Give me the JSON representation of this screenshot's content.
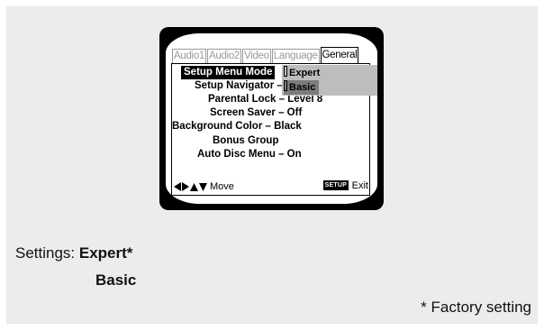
{
  "tabs": [
    {
      "label": "Audio1",
      "active": false
    },
    {
      "label": "Audio2",
      "active": false
    },
    {
      "label": "Video",
      "active": false
    },
    {
      "label": "Language",
      "active": false
    },
    {
      "label": "General",
      "active": true
    }
  ],
  "menu": {
    "setup_menu_mode": "Setup Menu Mode",
    "setup_navigator": "Setup Navigator –",
    "parental_lock": "Parental Lock – Level 8",
    "screen_saver": "Screen Saver – Off",
    "background_color": "Background Color – Black",
    "bonus_group": "Bonus Group",
    "auto_disc_menu": "Auto Disc Menu – On"
  },
  "dropdown": {
    "options": [
      "Expert",
      "Basic"
    ],
    "highlighted": "Basic"
  },
  "footer": {
    "move_label": "Move",
    "setup_key": "SETUP",
    "exit_label": "Exit"
  },
  "settings": {
    "prefix": "Settings: ",
    "default_option": "Expert*",
    "other_option": "Basic"
  },
  "note": "* Factory setting",
  "colors": {
    "screen_bg": "#ffffff",
    "selection_bg": "#000000",
    "dropdown_bg": "#bdbdbd",
    "dropdown_highlight": "#7c7c7c",
    "page_panel": "#ececec"
  }
}
